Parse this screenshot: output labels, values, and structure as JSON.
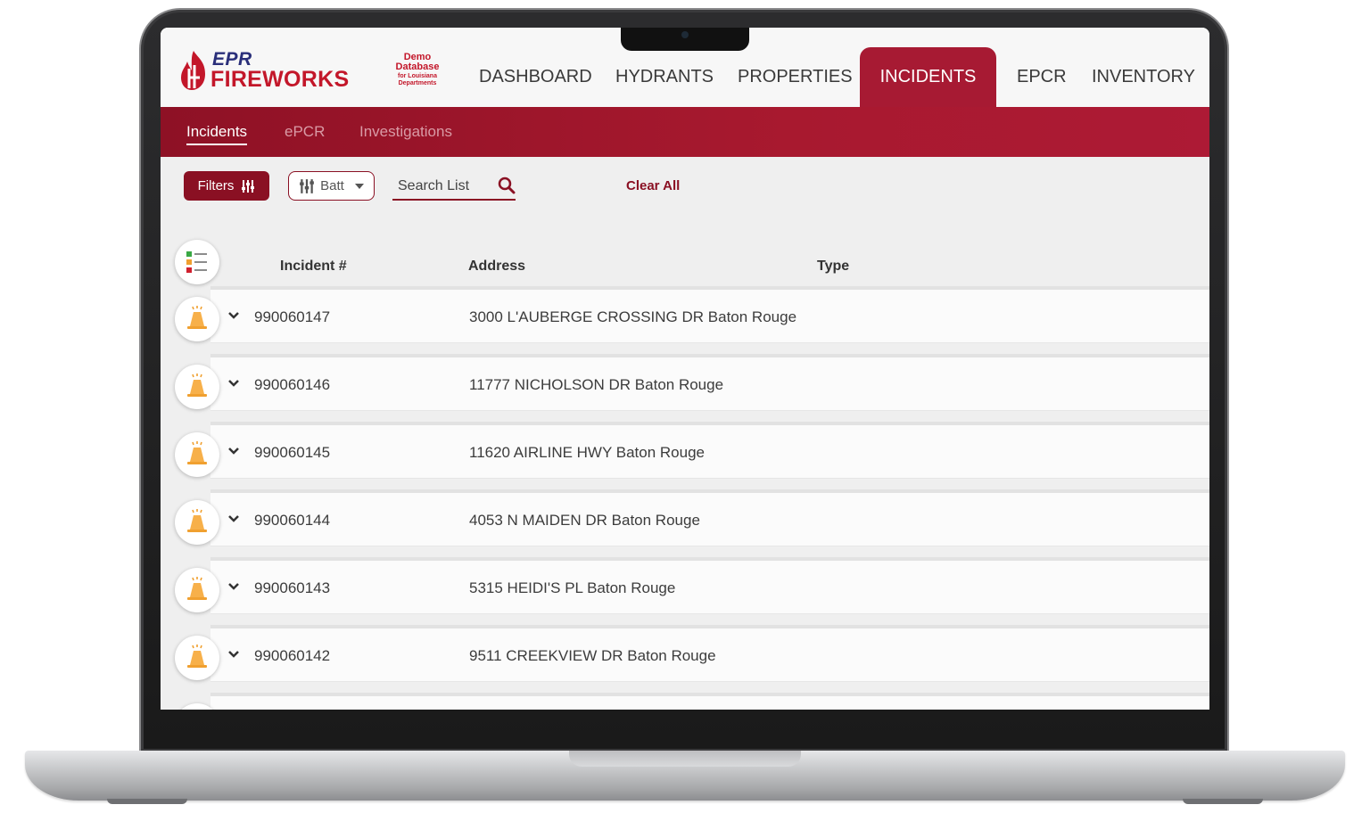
{
  "brand": {
    "logo_top": "EPR",
    "logo_bottom": "FIREWORKS",
    "demo_line1": "Demo",
    "demo_line2": "Database",
    "demo_line3": "for Louisiana",
    "demo_line4": "Departments",
    "primary_color": "#a71a33",
    "accent_color": "#c3172a"
  },
  "nav": {
    "items": [
      {
        "label": "DASHBOARD"
      },
      {
        "label": "HYDRANTS"
      },
      {
        "label": "PROPERTIES"
      },
      {
        "label": "INCIDENTS",
        "active": true
      },
      {
        "label": "EPCR"
      },
      {
        "label": "INVENTORY"
      }
    ]
  },
  "subnav": {
    "items": [
      {
        "label": "Incidents",
        "active": true
      },
      {
        "label": "ePCR"
      },
      {
        "label": "Investigations"
      }
    ]
  },
  "toolbar": {
    "filters_label": "Filters",
    "batt_label": "Batt",
    "search_placeholder": "Search List",
    "clear_all_label": "Clear All"
  },
  "table": {
    "columns": [
      "Incident #",
      "Address",
      "Type"
    ],
    "rows": [
      {
        "incident": "990060147",
        "address": "3000 L'AUBERGE CROSSING DR Baton Rouge",
        "icon": "alarm-icon"
      },
      {
        "incident": "990060146",
        "address": "11777 NICHOLSON DR Baton Rouge",
        "icon": "alarm-icon"
      },
      {
        "incident": "990060145",
        "address": "11620 AIRLINE HWY Baton Rouge",
        "icon": "alarm-icon"
      },
      {
        "incident": "990060144",
        "address": "4053 N MAIDEN DR Baton Rouge",
        "icon": "alarm-icon"
      },
      {
        "incident": "990060143",
        "address": "5315 HEIDI'S PL Baton Rouge",
        "icon": "alarm-icon"
      },
      {
        "incident": "990060142",
        "address": "9511 CREEKVIEW DR Baton Rouge",
        "icon": "alarm-icon"
      }
    ]
  }
}
